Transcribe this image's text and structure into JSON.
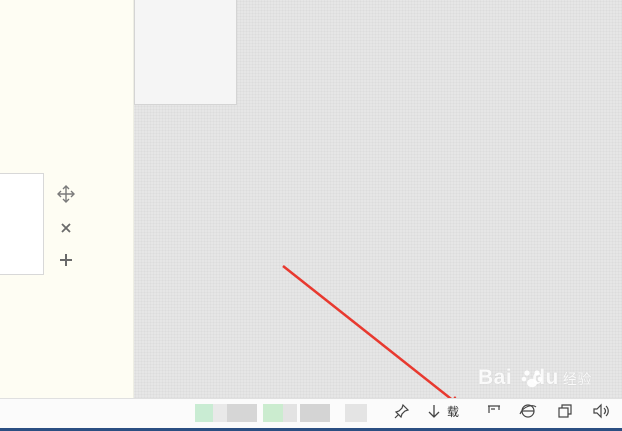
{
  "status_bar": {
    "download_label": "载",
    "icons": [
      "pin-icon",
      "download-icon",
      "screen-icon",
      "browser-icon",
      "window-icon",
      "volume-icon"
    ]
  },
  "side_tools": {
    "icons": [
      "move-icon",
      "close-icon",
      "add-icon"
    ]
  },
  "watermark": {
    "brand": "Bai",
    "brand_suffix": "du",
    "sub": "经验"
  },
  "colors": {
    "arrow": "#e8392f",
    "panel": "#fefdf3",
    "canvas": "#e6e6e6",
    "taskbar": "#2b4f82"
  }
}
